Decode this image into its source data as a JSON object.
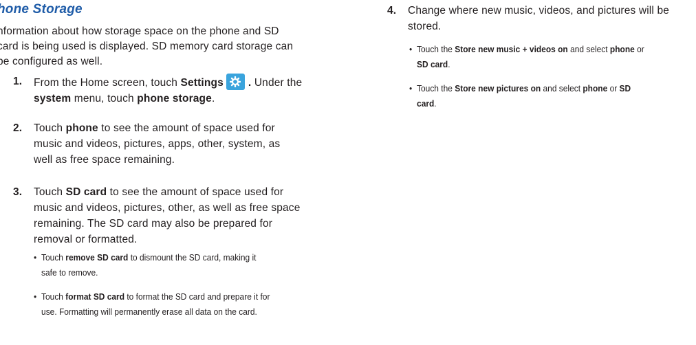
{
  "section": {
    "title": "hone Storage",
    "intro_lines": [
      "nformation about how storage space on the phone and SD",
      "card is being used is displayed. SD memory card storage can",
      "be configured as well."
    ]
  },
  "steps": [
    {
      "number": "1.",
      "lines": [
        [
          {
            "t": "From the Home screen, touch "
          },
          {
            "t": "Settings",
            "b": true
          },
          {
            "icon": "settings-gear-icon"
          },
          {
            "t": ". ",
            "b": true
          },
          {
            "t": "Under the"
          }
        ],
        [
          {
            "t": "system",
            "b": true
          },
          {
            "t": " menu, touch "
          },
          {
            "t": "phone storage",
            "b": true
          },
          {
            "t": "."
          }
        ]
      ]
    },
    {
      "number": "2.",
      "lines": [
        [
          {
            "t": "Touch "
          },
          {
            "t": "phone",
            "b": true
          },
          {
            "t": " to see the amount of space used for"
          }
        ],
        [
          {
            "t": "music and videos, pictures, apps, other, system, as"
          }
        ],
        [
          {
            "t": "well as free space remaining."
          }
        ]
      ]
    },
    {
      "number": "3.",
      "lines": [
        [
          {
            "t": "Touch "
          },
          {
            "t": "SD card",
            "b": true
          },
          {
            "t": " to see the amount of space used for"
          }
        ],
        [
          {
            "t": "music and videos, pictures, other, as well as free space"
          }
        ],
        [
          {
            "t": "remaining. The SD card may also be prepared for"
          }
        ],
        [
          {
            "t": "removal or formatted."
          }
        ]
      ],
      "bullets": [
        {
          "lines": [
            [
              {
                "t": "Touch "
              },
              {
                "t": "remove SD card",
                "b": true
              },
              {
                "t": " to dismount the SD card, making it"
              }
            ],
            [
              {
                "t": "safe to remove."
              }
            ]
          ]
        },
        {
          "lines": [
            [
              {
                "t": "Touch "
              },
              {
                "t": "format SD card",
                "b": true
              },
              {
                "t": " to format the SD card and prepare it for"
              }
            ],
            [
              {
                "t": "use. Formatting will permanently erase all data on the card."
              }
            ]
          ]
        }
      ]
    },
    {
      "number": "4.",
      "lines": [
        [
          {
            "t": "Change where new music, videos, and pictures will be"
          }
        ],
        [
          {
            "t": "stored."
          }
        ]
      ],
      "bullets": [
        {
          "lines": [
            [
              {
                "t": "Touch the "
              },
              {
                "t": "Store new music + videos on",
                "b": true
              },
              {
                "t": " and select "
              },
              {
                "t": "phone",
                "b": true
              },
              {
                "t": " or"
              }
            ],
            [
              {
                "t": "SD card",
                "b": true
              },
              {
                "t": "."
              }
            ]
          ]
        },
        {
          "lines": [
            [
              {
                "t": "Touch the "
              },
              {
                "t": "Store new pictures on",
                "b": true
              },
              {
                "t": " and select "
              },
              {
                "t": "phone",
                "b": true
              },
              {
                "t": " or "
              },
              {
                "t": "SD",
                "b": true
              }
            ],
            [
              {
                "t": "card",
                "b": true
              },
              {
                "t": "."
              }
            ]
          ]
        }
      ]
    }
  ],
  "bullet_glyph": "•",
  "colors": {
    "title": "#1f5ca8",
    "text": "#231f20",
    "gear_bg": "#3aa4dd"
  }
}
